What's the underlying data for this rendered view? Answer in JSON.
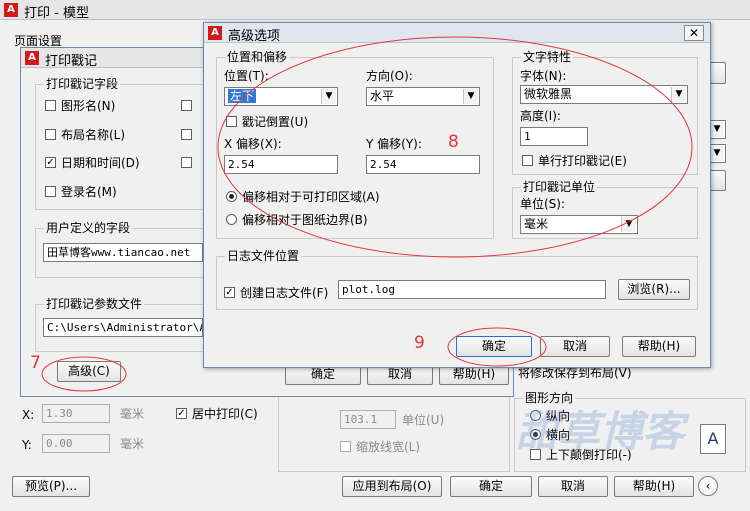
{
  "main": {
    "title": "打印 - 模型",
    "page_setup_label": "页面设置",
    "plot_offset": {
      "x_label": "X:",
      "x_value": "1.30",
      "y_label": "Y:",
      "y_value": "0.00",
      "unit": "毫米",
      "center_label": "居中打印(C)"
    },
    "scale": {
      "value": "103.1",
      "unit": "单位(U)",
      "lineweight_label": "缩放线宽(L)"
    },
    "shade_fragment": "将修改保存到布局(V)",
    "orientation": {
      "title": "图形方向",
      "portrait": "纵向",
      "landscape": "横向",
      "upside_down": "上下颠倒打印(-)"
    },
    "footer": {
      "preview": "预览(P)...",
      "apply_layout": "应用到布局(O)",
      "ok": "确定",
      "cancel": "取消",
      "help": "帮助(H)"
    },
    "watermark": "甜草博客"
  },
  "stamp": {
    "title": "打印戳记",
    "fields_group": "打印戳记字段",
    "fields": [
      {
        "label": "图形名(N)",
        "checked": false
      },
      {
        "label": "布局名称(L)",
        "checked": false
      },
      {
        "label": "日期和时间(D)",
        "checked": true
      },
      {
        "label": "登录名(M)",
        "checked": false
      }
    ],
    "user_group": "用户定义的字段",
    "user_value": "田草博客www.tiancao.net",
    "param_group": "打印戳记参数文件",
    "param_value": "C:\\Users\\Administrator\\AppData",
    "advanced_button": "高级(C)",
    "footer": {
      "ok": "确定",
      "cancel": "取消",
      "help": "帮助(H)"
    }
  },
  "advanced": {
    "title": "高级选项",
    "position_group": "位置和偏移",
    "position_label": "位置(T):",
    "position_value": "左下",
    "direction_label": "方向(O):",
    "direction_value": "水平",
    "upside_down_label": "戳记倒置(U)",
    "x_offset_label": "X 偏移(X):",
    "x_offset_value": "2.54",
    "y_offset_label": "Y 偏移(Y):",
    "y_offset_value": "2.54",
    "relative_printable": "偏移相对于可打印区域(A)",
    "relative_border": "偏移相对于图纸边界(B)",
    "text_group": "文字特性",
    "font_label": "字体(N):",
    "font_value": "微软雅黑",
    "height_label": "高度(I):",
    "height_value": "1",
    "single_line_label": "单行打印戳记(E)",
    "units_group": "打印戳记单位",
    "units_label": "单位(S):",
    "units_value": "毫米",
    "log_group": "日志文件位置",
    "log_create_label": "创建日志文件(F)",
    "log_value": "plot.log",
    "browse_button": "浏览(R)...",
    "ok_button": "确定",
    "cancel_button": "取消",
    "help_button": "帮助(H)"
  },
  "annotations": {
    "seven": "7",
    "eight": "8",
    "nine": "9"
  },
  "colors": {
    "annotation": "#e03838",
    "accent": "#3478d4",
    "title_icon": "#d21a1a"
  }
}
